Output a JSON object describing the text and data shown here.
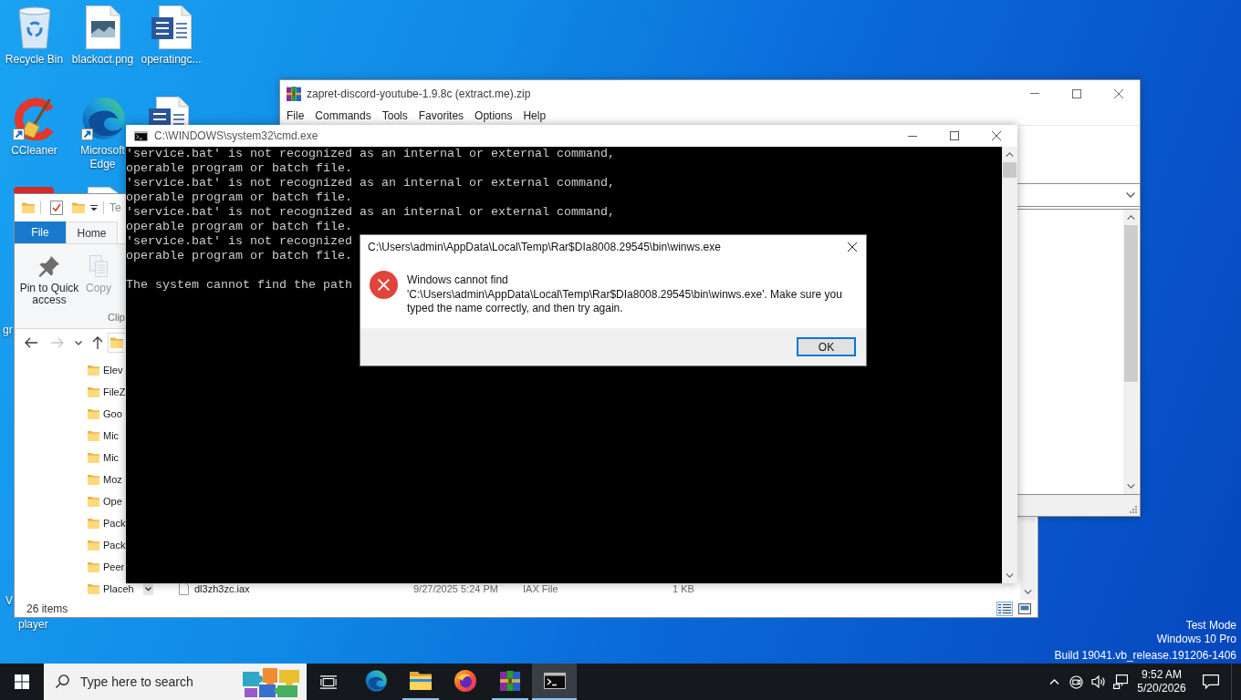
{
  "desktop": {
    "icons": [
      {
        "kind": "recycle_bin",
        "label": "Recycle Bin"
      },
      {
        "kind": "image_file",
        "label": "blackoct.png"
      },
      {
        "kind": "word_document",
        "label": "operatingc..."
      },
      {
        "kind": "ccleaner",
        "label": "CCleaner"
      },
      {
        "kind": "edge",
        "label": "Microsoft Edge"
      }
    ],
    "cut_labels": [
      "gr",
      "V",
      "player"
    ],
    "os_watermark": [
      "Test Mode",
      "Windows 10 Pro",
      "Build 19041.vb_release.191206-1406"
    ]
  },
  "explorer_window": {
    "title": "Te",
    "ribbon_tabs": [
      {
        "kind": "file_menu",
        "label": "File",
        "selected": false
      },
      {
        "kind": "tab",
        "label": "Home",
        "selected": true
      }
    ],
    "ribbon_buttons": [
      {
        "kind": "pin",
        "label": "Pin to Quick access",
        "disabled": false
      },
      {
        "kind": "copy",
        "label": "Copy",
        "disabled": true
      }
    ],
    "ribbon_group": "Clip",
    "nav_buttons": [
      {
        "kind": "back",
        "disabled": false
      },
      {
        "kind": "forward",
        "disabled": true
      },
      {
        "kind": "recent",
        "disabled": false
      },
      {
        "kind": "up",
        "disabled": false
      }
    ],
    "folders": [
      "Elev",
      "FileZ",
      "Goo",
      "Mic",
      "Mic",
      "Moz",
      "Ope",
      "Pack",
      "Pack",
      "Peer",
      "Placeh"
    ],
    "file": {
      "name": "dl3zh3zc.iax",
      "date": "9/27/2025 5:24 PM",
      "type": "IAX File",
      "size": "1 KB"
    },
    "status": "26 items",
    "views": [
      {
        "kind": "details",
        "selected": true
      },
      {
        "kind": "large_icons",
        "selected": false
      }
    ]
  },
  "winrar_window": {
    "title": "zapret-discord-youtube-1.9.8c (extract.me).zip",
    "menu": [
      "File",
      "Commands",
      "Tools",
      "Favorites",
      "Options",
      "Help"
    ]
  },
  "cmd_window": {
    "title": "C:\\WINDOWS\\system32\\cmd.exe",
    "blocks": [
      [
        "'service.bat' is not recognized as an internal or external command,",
        "operable program or batch file.",
        "'service.bat' is not recognized as an internal or external command,",
        "operable program or batch file.",
        "'service.bat' is not recognized as an internal or external command,",
        "operable program or batch file.",
        "'service.bat' is not recognized",
        "operable program or batch file."
      ],
      [
        "The system cannot find the path"
      ]
    ]
  },
  "error_dialog": {
    "title": "C:\\Users\\admin\\AppData\\Local\\Temp\\Rar$DIa8008.29545\\bin\\winws.exe",
    "message": "Windows cannot find 'C:\\Users\\admin\\AppData\\Local\\Temp\\Rar$DIa8008.29545\\bin\\winws.exe'. Make sure you typed the name correctly, and then try again.",
    "button": "OK"
  },
  "taskbar": {
    "search_placeholder": "Type here to search",
    "apps": [
      {
        "kind": "edge",
        "open": false,
        "active": false
      },
      {
        "kind": "explorer",
        "open": true,
        "active": false
      },
      {
        "kind": "firefox",
        "open": false,
        "active": false
      },
      {
        "kind": "winrar",
        "open": true,
        "active": false
      },
      {
        "kind": "cmd",
        "open": true,
        "active": true
      }
    ],
    "time": "9:52 AM",
    "date": "5/20/2026"
  }
}
